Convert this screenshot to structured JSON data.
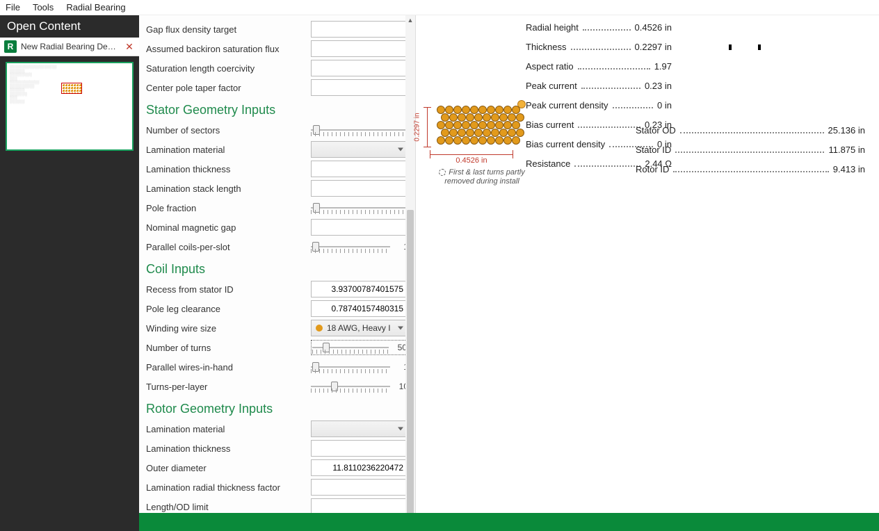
{
  "menubar": {
    "file": "File",
    "tools": "Tools",
    "radial": "Radial Bearing"
  },
  "sidebar": {
    "header": "Open Content",
    "app_icon_letter": "R",
    "tab_title": "New Radial Bearing Desi…",
    "close_glyph": "✕"
  },
  "form": {
    "top": [
      {
        "label": "Gap flux density target",
        "value": ""
      },
      {
        "label": "Assumed backiron saturation flux",
        "value": ""
      },
      {
        "label": "Saturation length coercivity",
        "value": ""
      },
      {
        "label": "Center pole taper factor",
        "value": ""
      }
    ],
    "stator_hdr": "Stator Geometry Inputs",
    "stator": {
      "num_sectors_label": "Number of sectors",
      "lam_material_label": "Lamination material",
      "lam_material_value": "",
      "lam_thickness_label": "Lamination thickness",
      "lam_stack_label": "Lamination stack length",
      "pole_fraction_label": "Pole fraction",
      "nom_gap_label": "Nominal magnetic gap",
      "par_coils_label": "Parallel coils-per-slot",
      "par_coils_value": "1"
    },
    "coil_hdr": "Coil Inputs",
    "coil": {
      "recess_label": "Recess from stator ID",
      "recess_value": "3.93700787401575",
      "pole_leg_label": "Pole leg clearance",
      "pole_leg_value": "0.78740157480315",
      "wire_label": "Winding wire size",
      "wire_value": "18 AWG, Heavy I",
      "turns_label": "Number of turns",
      "turns_value": "50",
      "pwih_label": "Parallel wires-in-hand",
      "pwih_value": "1",
      "tpl_label": "Turns-per-layer",
      "tpl_value": "10"
    },
    "rotor_hdr": "Rotor Geometry Inputs",
    "rotor": {
      "lam_material_label": "Lamination material",
      "lam_material_value": "",
      "lam_thickness_label": "Lamination thickness",
      "outer_dia_label": "Outer diameter",
      "outer_dia_value": "11.8110236220472",
      "lam_radial_label": "Lamination radial thickness factor",
      "length_od_label": "Length/OD limit"
    }
  },
  "coil_fig": {
    "width_label": "0.4526 in",
    "height_label": "0.2297 in",
    "note": "First & last turns partly removed during install"
  },
  "outputs_left": [
    {
      "k": "Radial height",
      "v": "0.4526 in"
    },
    {
      "k": "Thickness",
      "v": "0.2297 in"
    },
    {
      "k": "Aspect ratio",
      "v": "1.97"
    },
    {
      "k": "Peak current",
      "v": "0.23 in"
    },
    {
      "k": "Peak current density",
      "v": "0 in"
    },
    {
      "k": "Bias current",
      "v": "0.23 in"
    },
    {
      "k": "Bias current density",
      "v": "0 in"
    },
    {
      "k": "Resistance",
      "v": "2.44 Ω"
    }
  ],
  "outputs_right": [
    {
      "k": "Stator OD",
      "v": "25.136 in"
    },
    {
      "k": "Stator ID",
      "v": "11.875 in"
    },
    {
      "k": "Rotor ID",
      "v": "9.413 in"
    }
  ]
}
